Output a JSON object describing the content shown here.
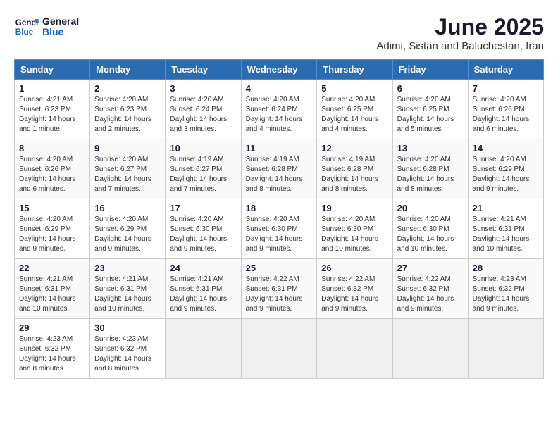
{
  "logo": {
    "line1": "General",
    "line2": "Blue"
  },
  "title": "June 2025",
  "subtitle": "Adimi, Sistan and Baluchestan, Iran",
  "days_of_week": [
    "Sunday",
    "Monday",
    "Tuesday",
    "Wednesday",
    "Thursday",
    "Friday",
    "Saturday"
  ],
  "weeks": [
    [
      {
        "day": "1",
        "info": "Sunrise: 4:21 AM\nSunset: 6:23 PM\nDaylight: 14 hours\nand 1 minute."
      },
      {
        "day": "2",
        "info": "Sunrise: 4:20 AM\nSunset: 6:23 PM\nDaylight: 14 hours\nand 2 minutes."
      },
      {
        "day": "3",
        "info": "Sunrise: 4:20 AM\nSunset: 6:24 PM\nDaylight: 14 hours\nand 3 minutes."
      },
      {
        "day": "4",
        "info": "Sunrise: 4:20 AM\nSunset: 6:24 PM\nDaylight: 14 hours\nand 4 minutes."
      },
      {
        "day": "5",
        "info": "Sunrise: 4:20 AM\nSunset: 6:25 PM\nDaylight: 14 hours\nand 4 minutes."
      },
      {
        "day": "6",
        "info": "Sunrise: 4:20 AM\nSunset: 6:25 PM\nDaylight: 14 hours\nand 5 minutes."
      },
      {
        "day": "7",
        "info": "Sunrise: 4:20 AM\nSunset: 6:26 PM\nDaylight: 14 hours\nand 6 minutes."
      }
    ],
    [
      {
        "day": "8",
        "info": "Sunrise: 4:20 AM\nSunset: 6:26 PM\nDaylight: 14 hours\nand 6 minutes."
      },
      {
        "day": "9",
        "info": "Sunrise: 4:20 AM\nSunset: 6:27 PM\nDaylight: 14 hours\nand 7 minutes."
      },
      {
        "day": "10",
        "info": "Sunrise: 4:19 AM\nSunset: 6:27 PM\nDaylight: 14 hours\nand 7 minutes."
      },
      {
        "day": "11",
        "info": "Sunrise: 4:19 AM\nSunset: 6:28 PM\nDaylight: 14 hours\nand 8 minutes."
      },
      {
        "day": "12",
        "info": "Sunrise: 4:19 AM\nSunset: 6:28 PM\nDaylight: 14 hours\nand 8 minutes."
      },
      {
        "day": "13",
        "info": "Sunrise: 4:20 AM\nSunset: 6:28 PM\nDaylight: 14 hours\nand 8 minutes."
      },
      {
        "day": "14",
        "info": "Sunrise: 4:20 AM\nSunset: 6:29 PM\nDaylight: 14 hours\nand 9 minutes."
      }
    ],
    [
      {
        "day": "15",
        "info": "Sunrise: 4:20 AM\nSunset: 6:29 PM\nDaylight: 14 hours\nand 9 minutes."
      },
      {
        "day": "16",
        "info": "Sunrise: 4:20 AM\nSunset: 6:29 PM\nDaylight: 14 hours\nand 9 minutes."
      },
      {
        "day": "17",
        "info": "Sunrise: 4:20 AM\nSunset: 6:30 PM\nDaylight: 14 hours\nand 9 minutes."
      },
      {
        "day": "18",
        "info": "Sunrise: 4:20 AM\nSunset: 6:30 PM\nDaylight: 14 hours\nand 9 minutes."
      },
      {
        "day": "19",
        "info": "Sunrise: 4:20 AM\nSunset: 6:30 PM\nDaylight: 14 hours\nand 10 minutes."
      },
      {
        "day": "20",
        "info": "Sunrise: 4:20 AM\nSunset: 6:30 PM\nDaylight: 14 hours\nand 10 minutes."
      },
      {
        "day": "21",
        "info": "Sunrise: 4:21 AM\nSunset: 6:31 PM\nDaylight: 14 hours\nand 10 minutes."
      }
    ],
    [
      {
        "day": "22",
        "info": "Sunrise: 4:21 AM\nSunset: 6:31 PM\nDaylight: 14 hours\nand 10 minutes."
      },
      {
        "day": "23",
        "info": "Sunrise: 4:21 AM\nSunset: 6:31 PM\nDaylight: 14 hours\nand 10 minutes."
      },
      {
        "day": "24",
        "info": "Sunrise: 4:21 AM\nSunset: 6:31 PM\nDaylight: 14 hours\nand 9 minutes."
      },
      {
        "day": "25",
        "info": "Sunrise: 4:22 AM\nSunset: 6:31 PM\nDaylight: 14 hours\nand 9 minutes."
      },
      {
        "day": "26",
        "info": "Sunrise: 4:22 AM\nSunset: 6:32 PM\nDaylight: 14 hours\nand 9 minutes."
      },
      {
        "day": "27",
        "info": "Sunrise: 4:22 AM\nSunset: 6:32 PM\nDaylight: 14 hours\nand 9 minutes."
      },
      {
        "day": "28",
        "info": "Sunrise: 4:23 AM\nSunset: 6:32 PM\nDaylight: 14 hours\nand 9 minutes."
      }
    ],
    [
      {
        "day": "29",
        "info": "Sunrise: 4:23 AM\nSunset: 6:32 PM\nDaylight: 14 hours\nand 8 minutes."
      },
      {
        "day": "30",
        "info": "Sunrise: 4:23 AM\nSunset: 6:32 PM\nDaylight: 14 hours\nand 8 minutes."
      },
      {
        "day": "",
        "info": ""
      },
      {
        "day": "",
        "info": ""
      },
      {
        "day": "",
        "info": ""
      },
      {
        "day": "",
        "info": ""
      },
      {
        "day": "",
        "info": ""
      }
    ]
  ]
}
